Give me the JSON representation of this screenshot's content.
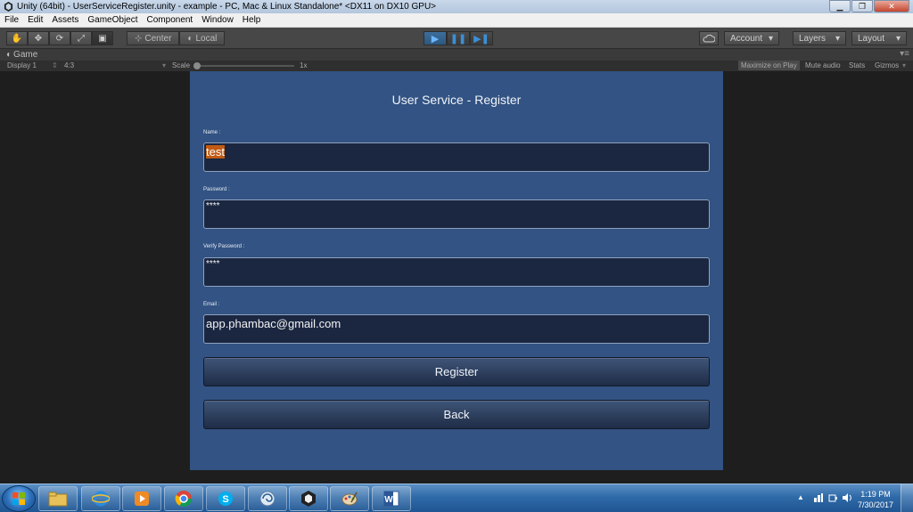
{
  "window": {
    "title": "Unity (64bit) - UserServiceRegister.unity - example - PC, Mac & Linux Standalone* <DX11 on DX10 GPU>"
  },
  "menu": [
    "File",
    "Edit",
    "Assets",
    "GameObject",
    "Component",
    "Window",
    "Help"
  ],
  "toolbar": {
    "pivot_center": "Center",
    "pivot_local": "Local",
    "account": "Account",
    "layers": "Layers",
    "layout": "Layout"
  },
  "game_view": {
    "tab_label": "Game",
    "display": "Display 1",
    "aspect": "4:3",
    "scale_label": "Scale",
    "scale_value": "1x",
    "maximize_on_play": "Maximize on Play",
    "mute_audio": "Mute audio",
    "stats": "Stats",
    "gizmos": "Gizmos"
  },
  "form": {
    "title": "User Service - Register",
    "name_label": "Name :",
    "name_value": "test",
    "password_label": "Password :",
    "password_value": "****",
    "verify_label": "Verify Password :",
    "verify_value": "****",
    "email_label": "Email :",
    "email_value": "app.phambac@gmail.com",
    "register_button": "Register",
    "back_button": "Back"
  },
  "taskbar": {
    "time": "1:19 PM",
    "date": "7/30/2017"
  },
  "colors": {
    "panel": "#325383",
    "field_bg": "#1b2741",
    "selection": "#c15a14"
  }
}
